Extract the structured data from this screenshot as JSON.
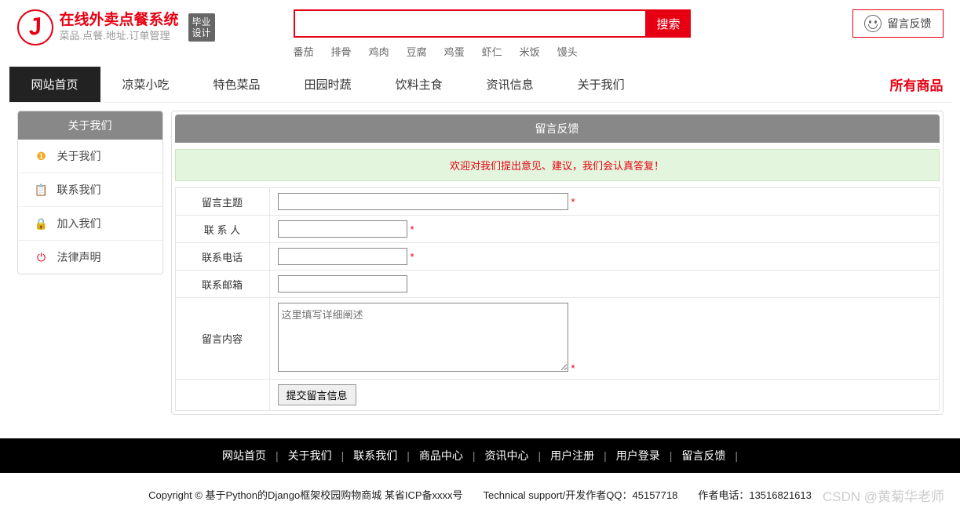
{
  "logo": {
    "title": "在线外卖点餐系统",
    "subtitle": "菜品.点餐.地址.订单管理",
    "badge_line1": "毕业",
    "badge_line2": "设计"
  },
  "search": {
    "button": "搜索",
    "hotwords": [
      "番茄",
      "排骨",
      "鸡肉",
      "豆腐",
      "鸡蛋",
      "虾仁",
      "米饭",
      "馒头"
    ]
  },
  "feedback_button": "留言反馈",
  "nav": {
    "items": [
      "网站首页",
      "凉菜小吃",
      "特色菜品",
      "田园时蔬",
      "饮料主食",
      "资讯信息",
      "关于我们"
    ],
    "all_goods": "所有商品"
  },
  "sidebar": {
    "title": "关于我们",
    "items": [
      {
        "label": "关于我们",
        "icon": "info"
      },
      {
        "label": "联系我们",
        "icon": "doc"
      },
      {
        "label": "加入我们",
        "icon": "lock"
      },
      {
        "label": "法律声明",
        "icon": "power"
      }
    ]
  },
  "content": {
    "title": "留言反馈",
    "welcome": "欢迎对我们提出意见、建议，我们会认真答复！",
    "form": {
      "subject": "留言主题",
      "contact": "联 系 人",
      "phone": "联系电话",
      "email": "联系邮箱",
      "body": "留言内容",
      "body_placeholder": "这里填写详细阐述",
      "submit": "提交留言信息"
    }
  },
  "footer": {
    "nav": [
      "网站首页",
      "关于我们",
      "联系我们",
      "商品中心",
      "资讯中心",
      "用户注册",
      "用户登录",
      "留言反馈"
    ],
    "copyright": "Copyright © 基于Python的Django框架校园购物商城 某省ICP备xxxx号　　Technical support/开发作者QQ：45157718　　作者电话：13516821613",
    "watermark": "CSDN @黄菊华老师"
  }
}
